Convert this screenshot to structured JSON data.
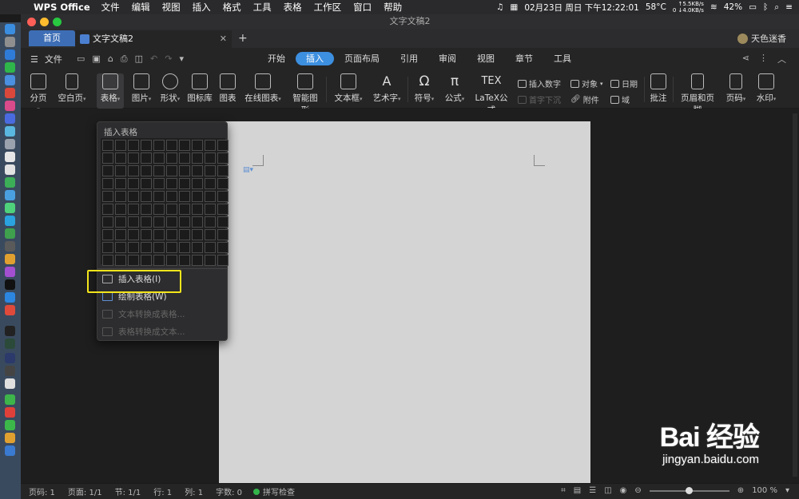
{
  "menubar": {
    "app_name": "WPS Office",
    "items": [
      "文件",
      "编辑",
      "视图",
      "插入",
      "格式",
      "工具",
      "表格",
      "工作区",
      "窗口",
      "帮助"
    ],
    "temp": "58°C",
    "net_up": "↑5.5KB/s",
    "net_down": "0 ↓4.0KB/s",
    "date_time": "02月23日 周日 下午12:22:01",
    "battery": "42%"
  },
  "window": {
    "title": "文字文稿2",
    "tabs": {
      "home": "首页",
      "doc": "文字文稿2"
    },
    "account": "天色迷香",
    "traffic_colors": [
      "#ff5f57",
      "#febc2e",
      "#28c840"
    ]
  },
  "toolbar": {
    "file_label": "文件",
    "ribbon_tabs": [
      "开始",
      "插入",
      "页面布局",
      "引用",
      "审阅",
      "视图",
      "章节",
      "工具"
    ],
    "active_tab": "插入"
  },
  "ribbon": {
    "fenye": "分页",
    "kongbaiye": "空白页",
    "biaoge": "表格",
    "tupian": "图片",
    "xingzhuang": "形状",
    "tubiaoku": "图标库",
    "tubiao": "图表",
    "zaixiantubiao": "在线图表",
    "zhinengtuxing": "智能图形",
    "wenbenkuang": "文本框",
    "yishuzi": "艺术字",
    "fuhao": "符号",
    "gongshi": "公式",
    "latex": "LaTeX公式",
    "crshuzi": "插入数字",
    "shouzixiachen": "首字下沉",
    "duixiang": "对象",
    "fujian": "附件",
    "riqi": "日期",
    "yu": "域",
    "pizhu": "批注",
    "yemei": "页眉和页脚",
    "yema": "页码",
    "shuiyin": "水印"
  },
  "table_dropdown": {
    "title": "插入表格",
    "items": {
      "insert": "插入表格(I)",
      "draw": "绘制表格(W)",
      "text_to_table": "文本转换成表格...",
      "table_to_text": "表格转换成文本..."
    }
  },
  "statusbar": {
    "page_code": "页码: 1",
    "page": "页面: 1/1",
    "section": "节: 1/1",
    "row": "行: 1",
    "col": "列: 1",
    "words": "字数: 0",
    "spell": "拼写检查",
    "zoom": "100 %"
  },
  "watermark": {
    "brand": "Bai  经验",
    "url": "jingyan.baidu.com"
  }
}
